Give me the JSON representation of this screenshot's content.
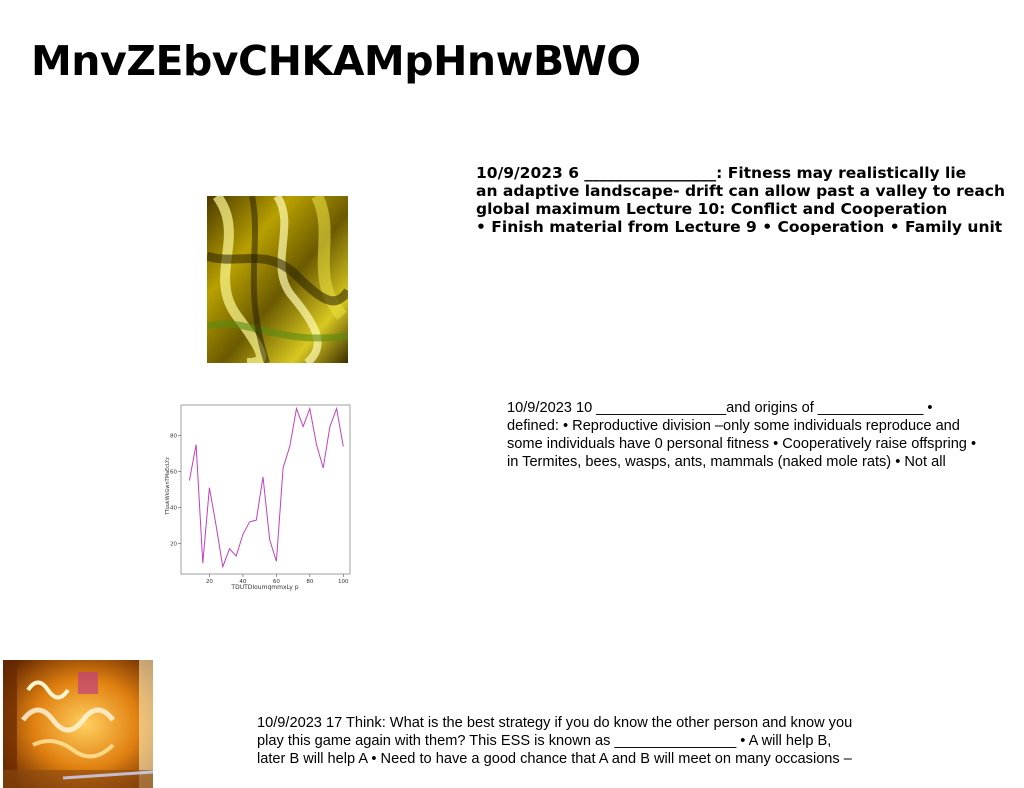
{
  "title": "MnvZEbvCHKAMpHnwBWO",
  "blocks": {
    "b1": [
      "10/9/2023 6 _________________: Fitness may realistically lie",
      "an adaptive landscape- drift can allow past a valley to reach",
      "global maximum Lecture 10: Conflict and Cooperation",
      "• Finish material from Lecture 9 • Cooperation • Family unit"
    ],
    "b2": [
      "10/9/2023 10 ________________and origins of _____________ •",
      "defined: • Reproductive division –only some individuals reproduce and",
      "some individuals have 0 personal fitness • Cooperatively raise offspring •",
      "in Termites, bees, wasps, ants, mammals (naked mole rats) • Not all"
    ],
    "b3": [
      "10/9/2023 17 Think: What is the best strategy if you do know the other person and know you",
      "play this game again with them? This ESS is known as _______________ • A will help B,",
      "later B will help A • Need to have a good chance that A and B will meet on many occasions –"
    ]
  },
  "images": {
    "gold": "abstract-gold-swirl-image",
    "graffiti": "orange-graffiti-photo"
  },
  "chart_data": {
    "type": "line",
    "xlabel": "TDUTDIoumqmmxLy p",
    "ylabel": "TTuukWkGwnTMaEcLYz",
    "xlim": [
      3,
      104
    ],
    "ylim": [
      3,
      97
    ],
    "xticks": [
      20,
      40,
      60,
      80,
      100
    ],
    "yticks": [
      20,
      40,
      60,
      80
    ],
    "color": "#c040c0",
    "x": [
      8,
      12,
      16,
      20,
      24,
      28,
      32,
      36,
      40,
      44,
      48,
      52,
      56,
      60,
      64,
      68,
      72,
      76,
      80,
      84,
      88,
      92,
      96,
      100
    ],
    "y": [
      55,
      75,
      9,
      51,
      30,
      7,
      17,
      13,
      25,
      32,
      33,
      57,
      22,
      10,
      62,
      74,
      95,
      85,
      95,
      75,
      62,
      85,
      95,
      74
    ]
  }
}
